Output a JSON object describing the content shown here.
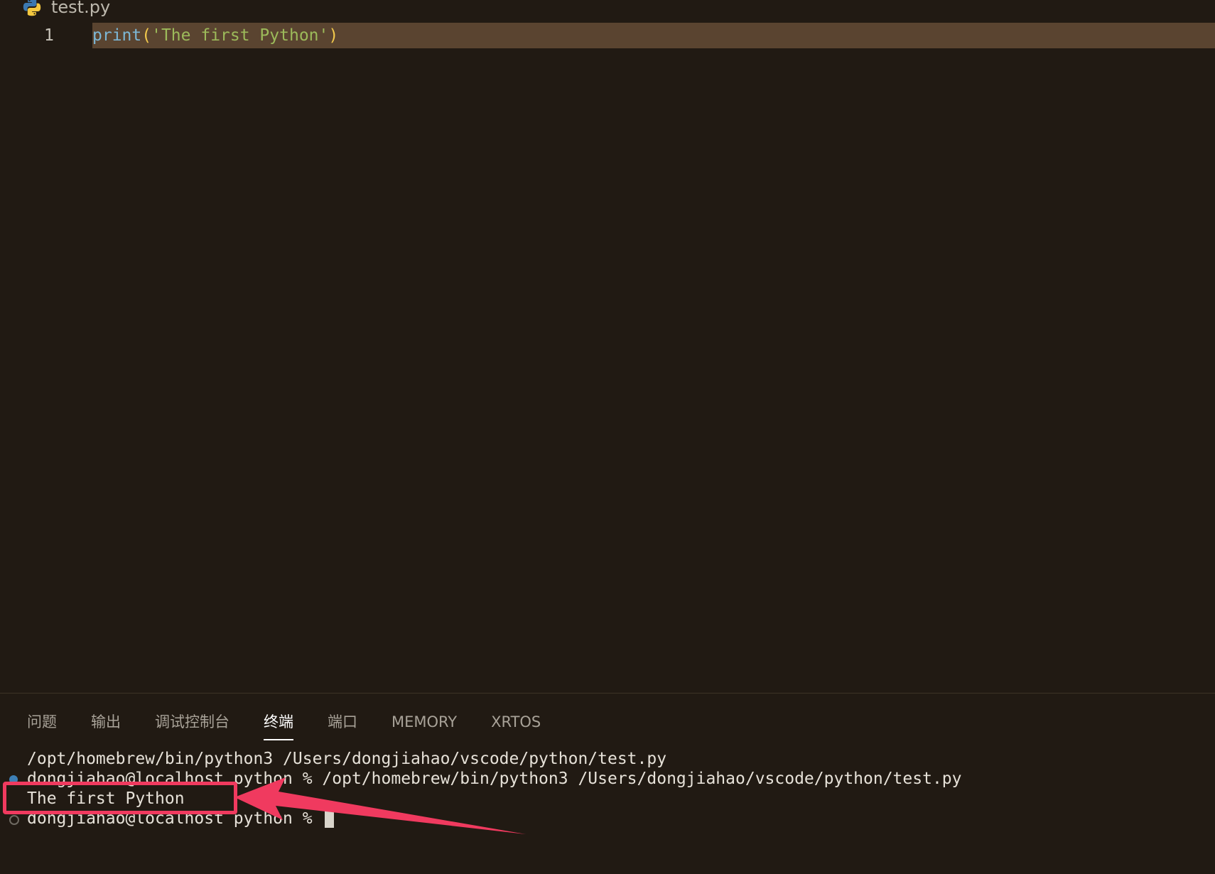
{
  "editor": {
    "file_tab": {
      "name": "test.py",
      "icon": "python-icon"
    },
    "lines": [
      {
        "number": "1",
        "tokens": {
          "fn": "print",
          "open": "(",
          "str": "'The first Python'",
          "close": ")"
        }
      }
    ]
  },
  "panel": {
    "tabs": [
      {
        "label": "问题"
      },
      {
        "label": "输出"
      },
      {
        "label": "调试控制台"
      },
      {
        "label": "终端",
        "active": true
      },
      {
        "label": "端口"
      },
      {
        "label": "MEMORY"
      },
      {
        "label": "XRTOS"
      }
    ]
  },
  "terminal": {
    "lines": [
      "/opt/homebrew/bin/python3 /Users/dongjiahao/vscode/python/test.py",
      "dongjiahao@localhost python % /opt/homebrew/bin/python3 /Users/dongjiahao/vscode/python/test.py",
      "The first Python",
      "dongjiahao@localhost python % "
    ]
  },
  "colors": {
    "background": "#211a13",
    "line_highlight": "#5a4430",
    "annotation": "#f03a5f",
    "success_dot": "#3d7fb5"
  }
}
